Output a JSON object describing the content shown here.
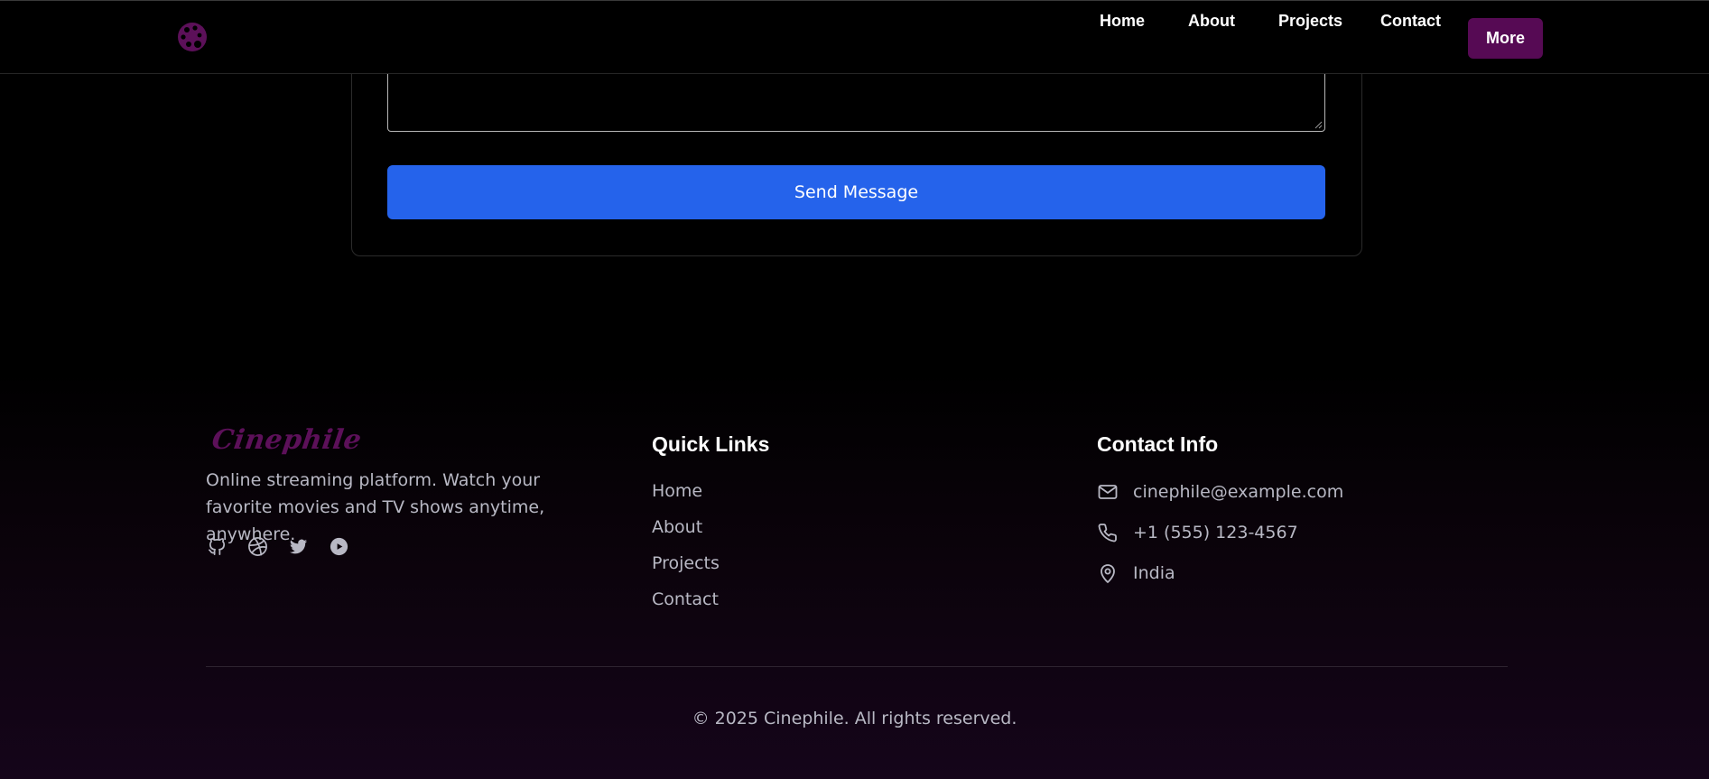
{
  "nav": {
    "links": [
      "Home",
      "About",
      "Projects",
      "Contact"
    ],
    "more_label": "More",
    "accent": "#560a54"
  },
  "form": {
    "textarea_value": "",
    "send_label": "Send Message",
    "button_color": "#2563eb"
  },
  "footer": {
    "brand": "Cinephile",
    "description": "Online streaming platform. Watch your favorite movies and TV shows anytime, anywhere.",
    "socials": [
      "github-icon",
      "dribbble-icon",
      "twitter-icon",
      "youtube-icon"
    ],
    "quick_links_heading": "Quick Links",
    "quick_links": [
      "Home",
      "About",
      "Projects",
      "Contact"
    ],
    "contact_heading": "Contact Info",
    "contact": {
      "email": "cinephile@example.com",
      "phone": "+1 (555) 123-4567",
      "location": "India"
    },
    "copyright": "© 2025 Cinephile. All rights reserved."
  }
}
